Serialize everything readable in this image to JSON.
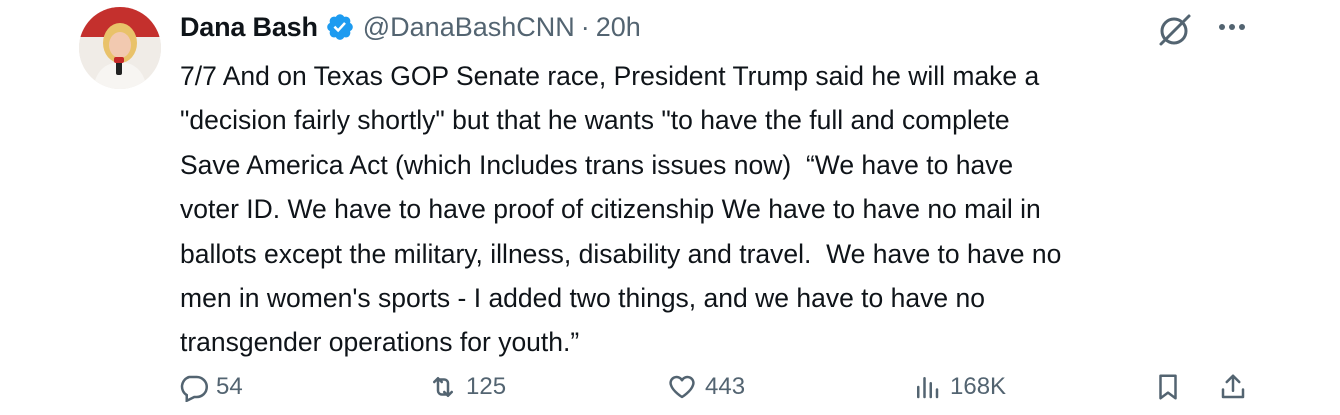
{
  "tweet": {
    "author_name": "Dana Bash",
    "handle": "@DanaBashCNN",
    "separator": "·",
    "time": "20h",
    "text": "7/7 And on Texas GOP Senate race, President Trump said he will make a\n\"decision fairly shortly\" but that he wants \"to have the full and complete\nSave America Act (which Includes trans issues now)  “We have to have\nvoter ID. We have to have proof of citizenship We have to have no mail in\nballots except the military, illness, disability and travel.  We have to have no\nmen in women's sports - I added two things, and we have to have no\ntransgender operations for youth.”"
  },
  "actions": {
    "replies": "54",
    "reposts": "125",
    "likes": "443",
    "views": "168K"
  },
  "icons": [
    "verified-badge-icon",
    "grok-icon",
    "more-icon",
    "reply-icon",
    "repost-icon",
    "like-icon",
    "views-icon",
    "bookmark-icon",
    "share-icon"
  ],
  "colors": {
    "verified": "#1d9bf0",
    "text": "#0f1419",
    "secondary": "#536471"
  }
}
